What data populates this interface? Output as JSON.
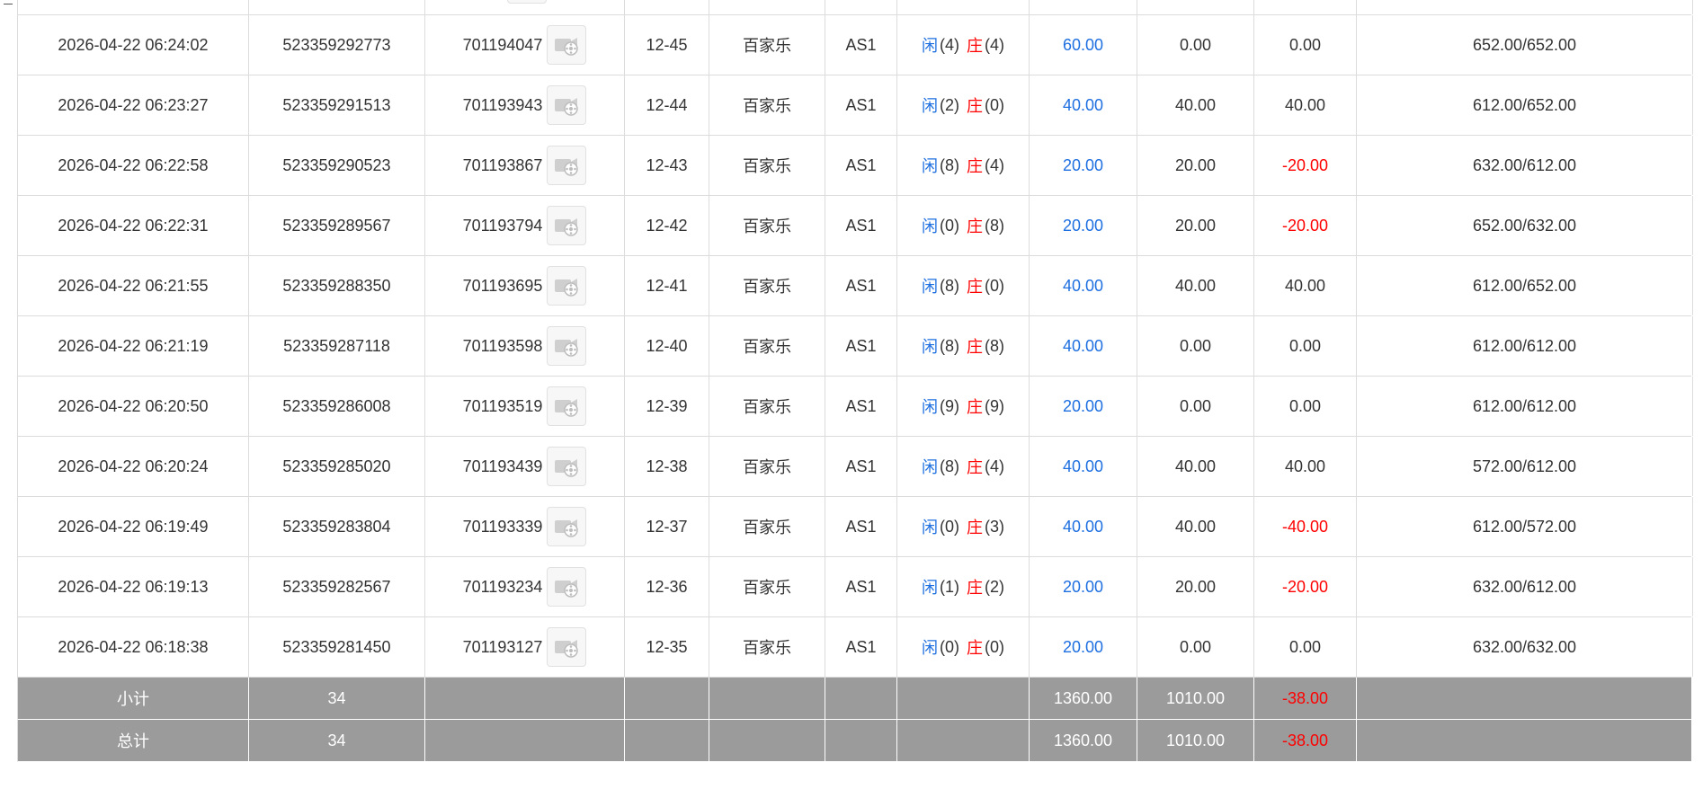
{
  "rows": [
    {
      "time": "",
      "bet_id": "",
      "game_id": "",
      "round": "",
      "game": "",
      "table": "",
      "result": null,
      "bet": "",
      "valid": "",
      "win_loss": "",
      "balance": ""
    },
    {
      "time": "2026-04-22 06:24:02",
      "bet_id": "523359292773",
      "game_id": "701194047",
      "round": "12-45",
      "game": "百家乐",
      "table": "AS1",
      "result": {
        "player_label": "闲",
        "player": "(4)",
        "banker_label": "庄",
        "banker": "(4)"
      },
      "bet": "60.00",
      "valid": "0.00",
      "win_loss": "0.00",
      "balance": "652.00/652.00"
    },
    {
      "time": "2026-04-22 06:23:27",
      "bet_id": "523359291513",
      "game_id": "701193943",
      "round": "12-44",
      "game": "百家乐",
      "table": "AS1",
      "result": {
        "player_label": "闲",
        "player": "(2)",
        "banker_label": "庄",
        "banker": "(0)"
      },
      "bet": "40.00",
      "valid": "40.00",
      "win_loss": "40.00",
      "balance": "612.00/652.00"
    },
    {
      "time": "2026-04-22 06:22:58",
      "bet_id": "523359290523",
      "game_id": "701193867",
      "round": "12-43",
      "game": "百家乐",
      "table": "AS1",
      "result": {
        "player_label": "闲",
        "player": "(8)",
        "banker_label": "庄",
        "banker": "(4)"
      },
      "bet": "20.00",
      "valid": "20.00",
      "win_loss": "-20.00",
      "balance": "632.00/612.00"
    },
    {
      "time": "2026-04-22 06:22:31",
      "bet_id": "523359289567",
      "game_id": "701193794",
      "round": "12-42",
      "game": "百家乐",
      "table": "AS1",
      "result": {
        "player_label": "闲",
        "player": "(0)",
        "banker_label": "庄",
        "banker": "(8)"
      },
      "bet": "20.00",
      "valid": "20.00",
      "win_loss": "-20.00",
      "balance": "652.00/632.00"
    },
    {
      "time": "2026-04-22 06:21:55",
      "bet_id": "523359288350",
      "game_id": "701193695",
      "round": "12-41",
      "game": "百家乐",
      "table": "AS1",
      "result": {
        "player_label": "闲",
        "player": "(8)",
        "banker_label": "庄",
        "banker": "(0)"
      },
      "bet": "40.00",
      "valid": "40.00",
      "win_loss": "40.00",
      "balance": "612.00/652.00"
    },
    {
      "time": "2026-04-22 06:21:19",
      "bet_id": "523359287118",
      "game_id": "701193598",
      "round": "12-40",
      "game": "百家乐",
      "table": "AS1",
      "result": {
        "player_label": "闲",
        "player": "(8)",
        "banker_label": "庄",
        "banker": "(8)"
      },
      "bet": "40.00",
      "valid": "0.00",
      "win_loss": "0.00",
      "balance": "612.00/612.00"
    },
    {
      "time": "2026-04-22 06:20:50",
      "bet_id": "523359286008",
      "game_id": "701193519",
      "round": "12-39",
      "game": "百家乐",
      "table": "AS1",
      "result": {
        "player_label": "闲",
        "player": "(9)",
        "banker_label": "庄",
        "banker": "(9)"
      },
      "bet": "20.00",
      "valid": "0.00",
      "win_loss": "0.00",
      "balance": "612.00/612.00"
    },
    {
      "time": "2026-04-22 06:20:24",
      "bet_id": "523359285020",
      "game_id": "701193439",
      "round": "12-38",
      "game": "百家乐",
      "table": "AS1",
      "result": {
        "player_label": "闲",
        "player": "(8)",
        "banker_label": "庄",
        "banker": "(4)"
      },
      "bet": "40.00",
      "valid": "40.00",
      "win_loss": "40.00",
      "balance": "572.00/612.00"
    },
    {
      "time": "2026-04-22 06:19:49",
      "bet_id": "523359283804",
      "game_id": "701193339",
      "round": "12-37",
      "game": "百家乐",
      "table": "AS1",
      "result": {
        "player_label": "闲",
        "player": "(0)",
        "banker_label": "庄",
        "banker": "(3)"
      },
      "bet": "40.00",
      "valid": "40.00",
      "win_loss": "-40.00",
      "balance": "612.00/572.00"
    },
    {
      "time": "2026-04-22 06:19:13",
      "bet_id": "523359282567",
      "game_id": "701193234",
      "round": "12-36",
      "game": "百家乐",
      "table": "AS1",
      "result": {
        "player_label": "闲",
        "player": "(1)",
        "banker_label": "庄",
        "banker": "(2)"
      },
      "bet": "20.00",
      "valid": "20.00",
      "win_loss": "-20.00",
      "balance": "632.00/612.00"
    },
    {
      "time": "2026-04-22 06:18:38",
      "bet_id": "523359281450",
      "game_id": "701193127",
      "round": "12-35",
      "game": "百家乐",
      "table": "AS1",
      "result": {
        "player_label": "闲",
        "player": "(0)",
        "banker_label": "庄",
        "banker": "(0)"
      },
      "bet": "20.00",
      "valid": "0.00",
      "win_loss": "0.00",
      "balance": "632.00/632.00"
    }
  ],
  "subtotal": {
    "label": "小计",
    "count": "34",
    "bet": "1360.00",
    "valid": "1010.00",
    "win_loss": "-38.00"
  },
  "total": {
    "label": "总计",
    "count": "34",
    "bet": "1360.00",
    "valid": "1010.00",
    "win_loss": "-38.00"
  },
  "colors": {
    "blue": "#1e6fe0",
    "red": "#ff0000",
    "footer_bg": "#9b9b9b",
    "border": "#dcdcdc"
  },
  "icons": {
    "video": "video-replay-icon"
  }
}
